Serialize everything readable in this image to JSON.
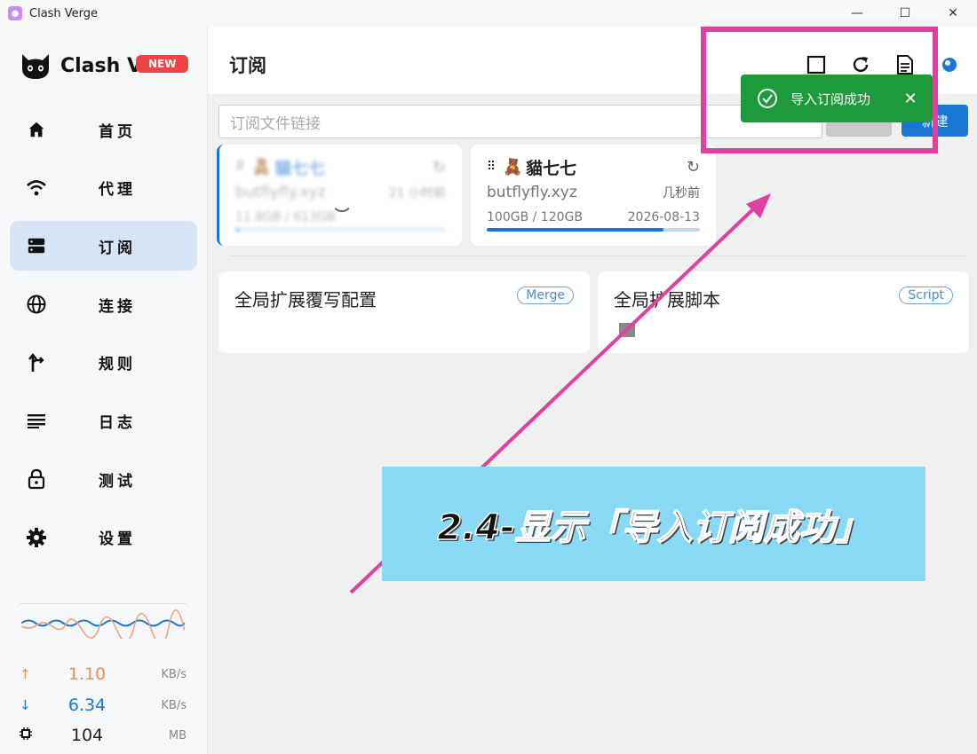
{
  "window": {
    "title": "Clash Verge",
    "controls": [
      "minimize",
      "maximize",
      "close"
    ]
  },
  "sidebar": {
    "logo_text": "Clash V",
    "new_badge": "NEW",
    "items": [
      {
        "label": "首页",
        "icon": "home-icon",
        "active": false
      },
      {
        "label": "代理",
        "icon": "wifi-icon",
        "active": false
      },
      {
        "label": "订阅",
        "icon": "storage-icon",
        "active": true
      },
      {
        "label": "连接",
        "icon": "globe-icon",
        "active": false
      },
      {
        "label": "规则",
        "icon": "fork-arrow-icon",
        "active": false
      },
      {
        "label": "日志",
        "icon": "list-icon",
        "active": false
      },
      {
        "label": "测试",
        "icon": "lock-icon",
        "active": false
      },
      {
        "label": "设置",
        "icon": "gear-icon",
        "active": false
      }
    ],
    "stats": {
      "upload": {
        "value": "1.10",
        "unit": "KB/s",
        "color": "#f08a5d"
      },
      "download": {
        "value": "6.34",
        "unit": "KB/s",
        "color": "#1976d2"
      },
      "memory": {
        "value": "104",
        "unit": "MB"
      }
    }
  },
  "header": {
    "title": "订阅"
  },
  "import": {
    "placeholder": "订阅文件链接",
    "new_button": "新建"
  },
  "profiles": [
    {
      "name": "貓七七",
      "host": "butflyfly.xyz",
      "updated": "21 小时前",
      "usage": "11.8GB / 613GB",
      "expire": "",
      "progress": 0.02,
      "selected": true
    },
    {
      "name": "貓七七",
      "host": "butflyfly.xyz",
      "updated": "几秒前",
      "usage": "100GB / 120GB",
      "expire": "2026-08-13",
      "progress": 0.83,
      "selected": false
    }
  ],
  "extensions": [
    {
      "title": "全局扩展覆写配置",
      "badge": "Merge"
    },
    {
      "title": "全局扩展脚本",
      "badge": "Script"
    }
  ],
  "toast": {
    "message": "导入订阅成功",
    "color": "#1c9a3c"
  },
  "annotation": {
    "caption": "2.4-显示「导入订阅成功」",
    "accent": "#e040a0",
    "caption_bg": "#8ad9f4"
  }
}
